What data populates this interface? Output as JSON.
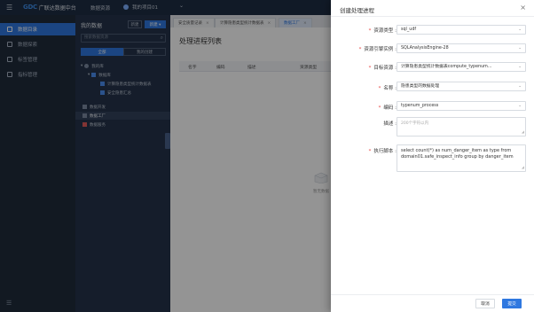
{
  "topbar": {
    "logo_badge": "GDC",
    "logo_text": "广联达数据中台",
    "nav_data_assets": "数据资源",
    "nav_workspace": "我的项目01",
    "nav_more": "⌄"
  },
  "leftnav": {
    "items": [
      {
        "label": "数据目录"
      },
      {
        "label": "数据探索"
      },
      {
        "label": "标签管理"
      },
      {
        "label": "指标管理"
      }
    ],
    "collapse_glyph": "☰"
  },
  "treepanel": {
    "title": "我的数据",
    "btn_import": "新建",
    "btn_new": "新建 ▾",
    "search_placeholder": "搜索数据资源",
    "tab_all": "全部",
    "tab_mine": "我的创建",
    "nodes": [
      {
        "label": "我的库"
      },
      {
        "label": "数据库"
      },
      {
        "label": "计算隐患类型统计数据表"
      },
      {
        "label": "安全隐患汇总"
      },
      {
        "label": "数据开发"
      },
      {
        "label": "数据工厂"
      },
      {
        "label": "数据服务"
      }
    ]
  },
  "tabs": [
    {
      "label": "安全质量记录"
    },
    {
      "label": "计算隐患类型统计数据表"
    },
    {
      "label": "数据工厂"
    }
  ],
  "content": {
    "page_title": "处理进程列表",
    "columns": [
      "名字",
      "编码",
      "描述",
      "资源类型"
    ],
    "empty_text": "暂无数据"
  },
  "drawer": {
    "title": "创建处理进程",
    "fields": {
      "resource_type": {
        "label": "资源类型",
        "value": "sql_udf"
      },
      "resource_engine": {
        "label": "资源引擎实例",
        "value": "SQLAnalysisEngine-28"
      },
      "target_resource": {
        "label": "目标资源",
        "value": "计算隐患类型统计数据表compute_typenum..."
      },
      "name": {
        "label": "名称",
        "value": "隐患类型的数据处理"
      },
      "code": {
        "label": "编码",
        "value": "typenum_process"
      },
      "description": {
        "label": "描述",
        "placeholder": "200个字符以内"
      },
      "script": {
        "label": "执行脚本",
        "value": "select count(*) as num_danger_item as type from domain01.safe_inspect_info group by danger_item"
      }
    },
    "btn_cancel": "取消",
    "btn_submit": "提交"
  }
}
